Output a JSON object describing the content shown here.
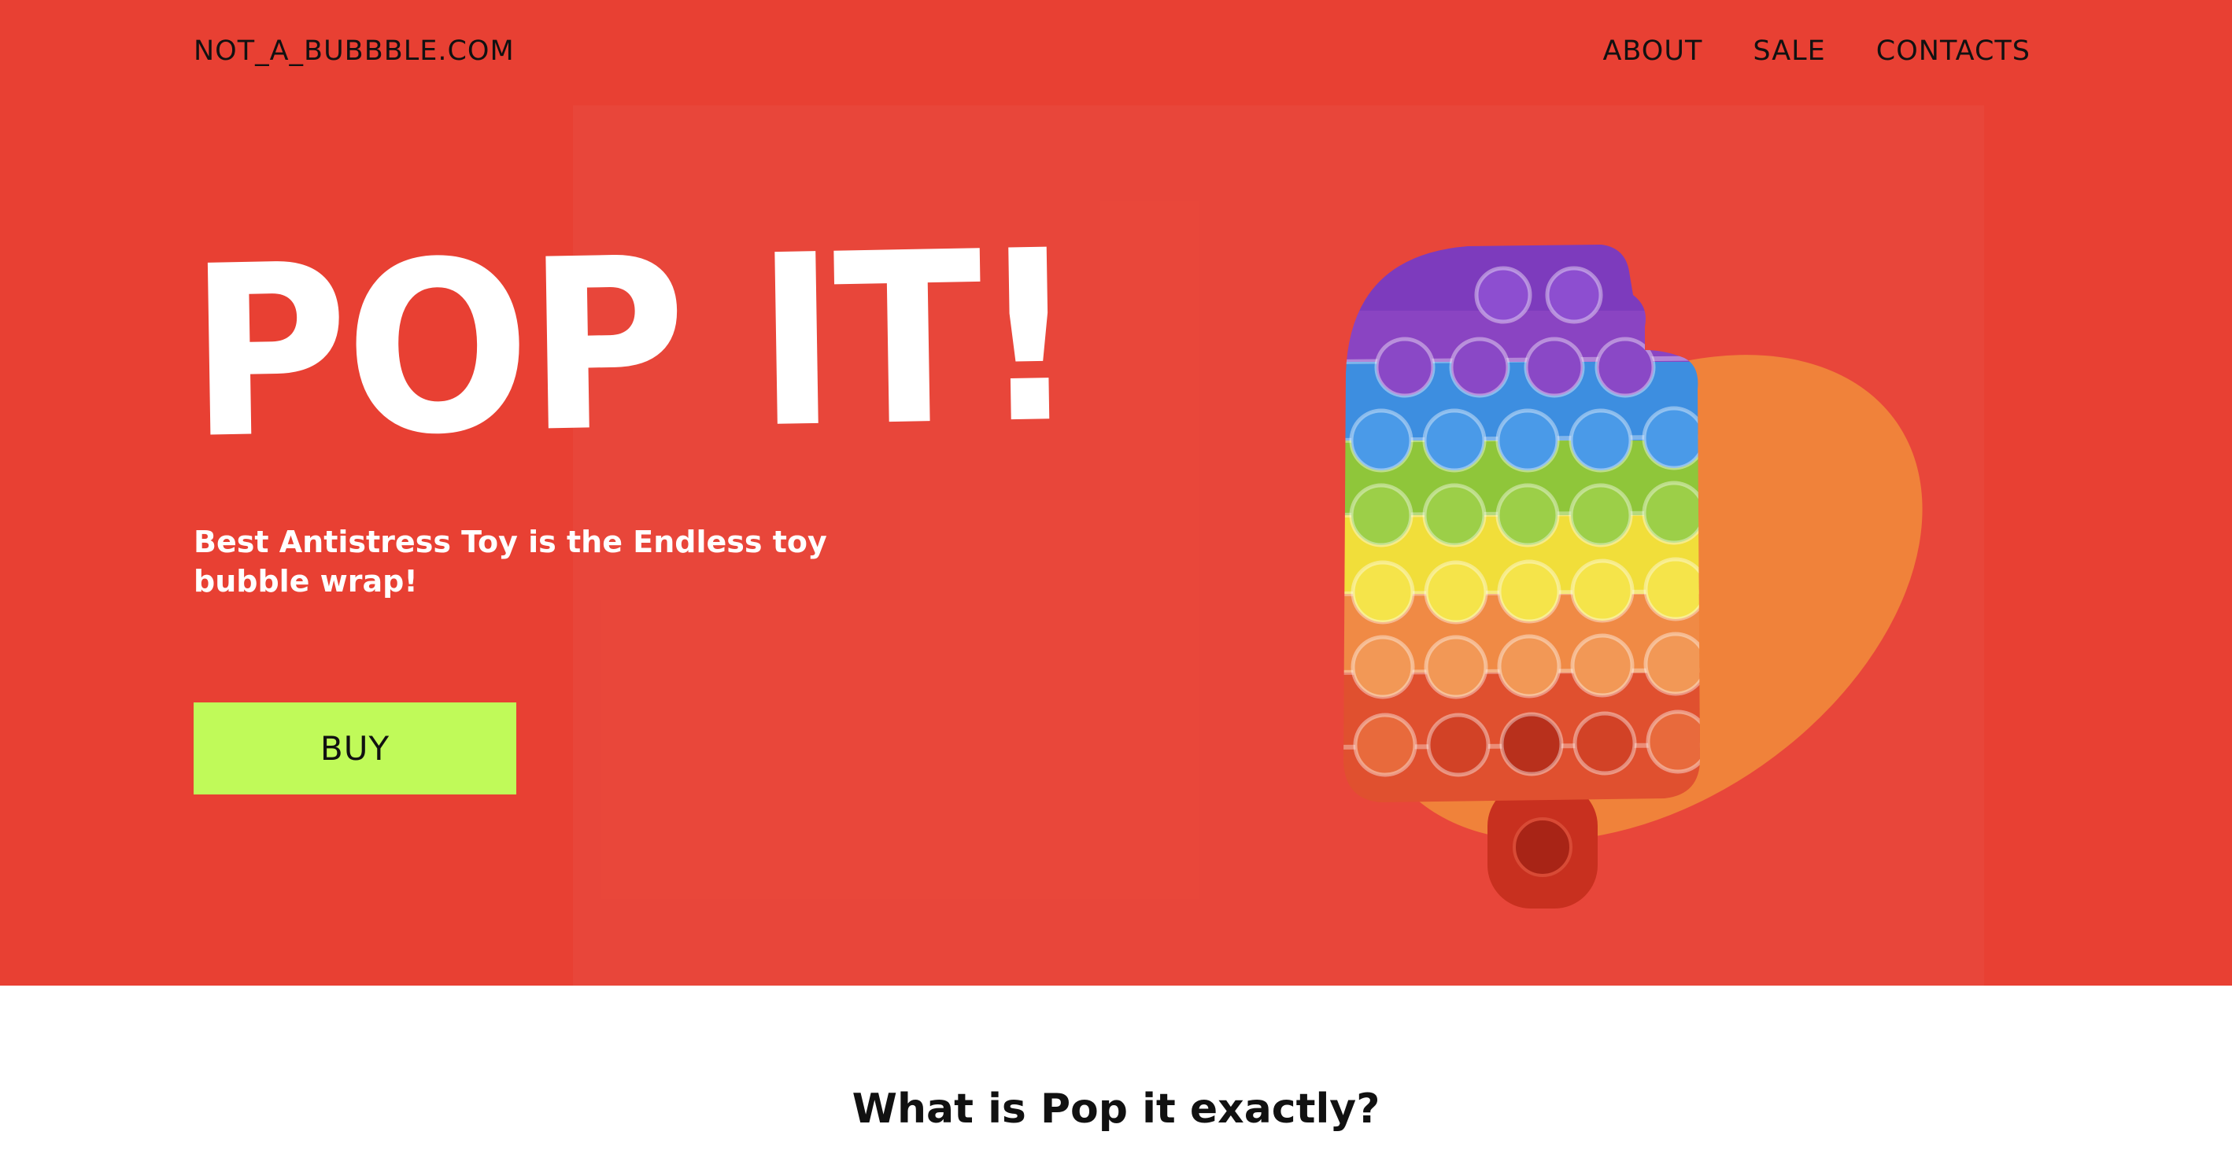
{
  "header": {
    "brand": "NOT_A_BUBBBLE.COM",
    "nav": [
      {
        "label": "ABOUT"
      },
      {
        "label": "SALE"
      },
      {
        "label": "CONTACTS"
      }
    ]
  },
  "hero": {
    "title": "POP IT!",
    "subtitle": "Best Antistress Toy is the Endless toy bubble wrap!",
    "buy_label": "BUY",
    "image_icon": "rainbow-popsicle-pop-it-toy"
  },
  "section": {
    "title": "What is Pop it exactly?"
  },
  "colors": {
    "hero_bg": "#e84033",
    "accent_button": "#c0fa59",
    "blob": "#f0823a",
    "text_dark": "#111111",
    "text_light": "#ffffff"
  }
}
